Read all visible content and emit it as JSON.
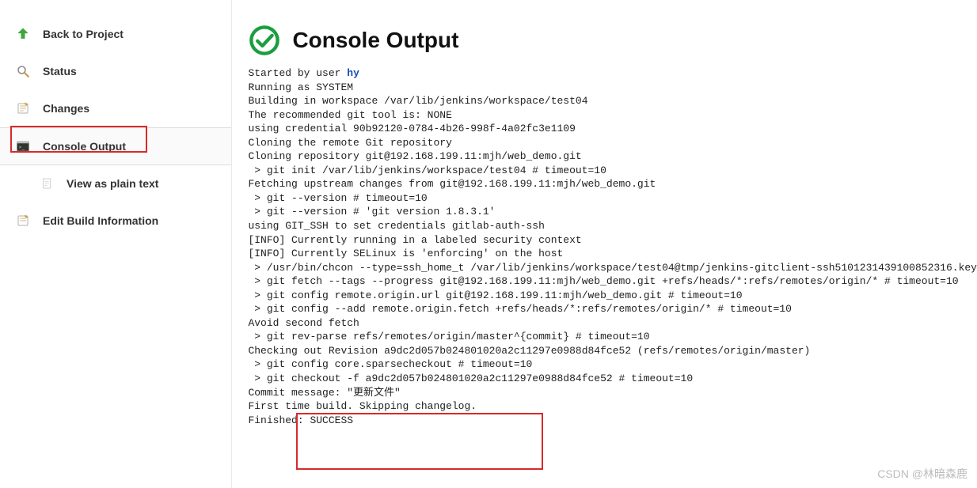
{
  "sidebar": {
    "items": [
      {
        "label": "Back to Project",
        "name": "back-to-project",
        "icon": "up-arrow"
      },
      {
        "label": "Status",
        "name": "status",
        "icon": "magnifier"
      },
      {
        "label": "Changes",
        "name": "changes",
        "icon": "notepad"
      },
      {
        "label": "Console Output",
        "name": "console-output",
        "icon": "terminal",
        "active": true,
        "children": [
          {
            "label": "View as plain text",
            "name": "view-plain-text",
            "icon": "document"
          }
        ]
      },
      {
        "label": "Edit Build Information",
        "name": "edit-build-info",
        "icon": "notepad-edit"
      }
    ]
  },
  "page": {
    "title": "Console Output",
    "started_prefix": "Started by user ",
    "started_user": "hy"
  },
  "console_lines": [
    "Running as SYSTEM",
    "Building in workspace /var/lib/jenkins/workspace/test04",
    "The recommended git tool is: NONE",
    "using credential 90b92120-0784-4b26-998f-4a02fc3e1109",
    "Cloning the remote Git repository",
    "Cloning repository git@192.168.199.11:mjh/web_demo.git",
    " > git init /var/lib/jenkins/workspace/test04 # timeout=10",
    "Fetching upstream changes from git@192.168.199.11:mjh/web_demo.git",
    " > git --version # timeout=10",
    " > git --version # 'git version 1.8.3.1'",
    "using GIT_SSH to set credentials gitlab-auth-ssh",
    "[INFO] Currently running in a labeled security context",
    "[INFO] Currently SELinux is 'enforcing' on the host",
    " > /usr/bin/chcon --type=ssh_home_t /var/lib/jenkins/workspace/test04@tmp/jenkins-gitclient-ssh5101231439100852316.key",
    " > git fetch --tags --progress git@192.168.199.11:mjh/web_demo.git +refs/heads/*:refs/remotes/origin/* # timeout=10",
    " > git config remote.origin.url git@192.168.199.11:mjh/web_demo.git # timeout=10",
    " > git config --add remote.origin.fetch +refs/heads/*:refs/remotes/origin/* # timeout=10",
    "Avoid second fetch",
    " > git rev-parse refs/remotes/origin/master^{commit} # timeout=10",
    "Checking out Revision a9dc2d057b024801020a2c11297e0988d84fce52 (refs/remotes/origin/master)",
    " > git config core.sparsecheckout # timeout=10",
    " > git checkout -f a9dc2d057b024801020a2c11297e0988d84fce52 # timeout=10",
    "Commit message: \"更新文件\"",
    "First time build. Skipping changelog.",
    "Finished: SUCCESS"
  ],
  "watermark": "CSDN @林暗森鹿"
}
